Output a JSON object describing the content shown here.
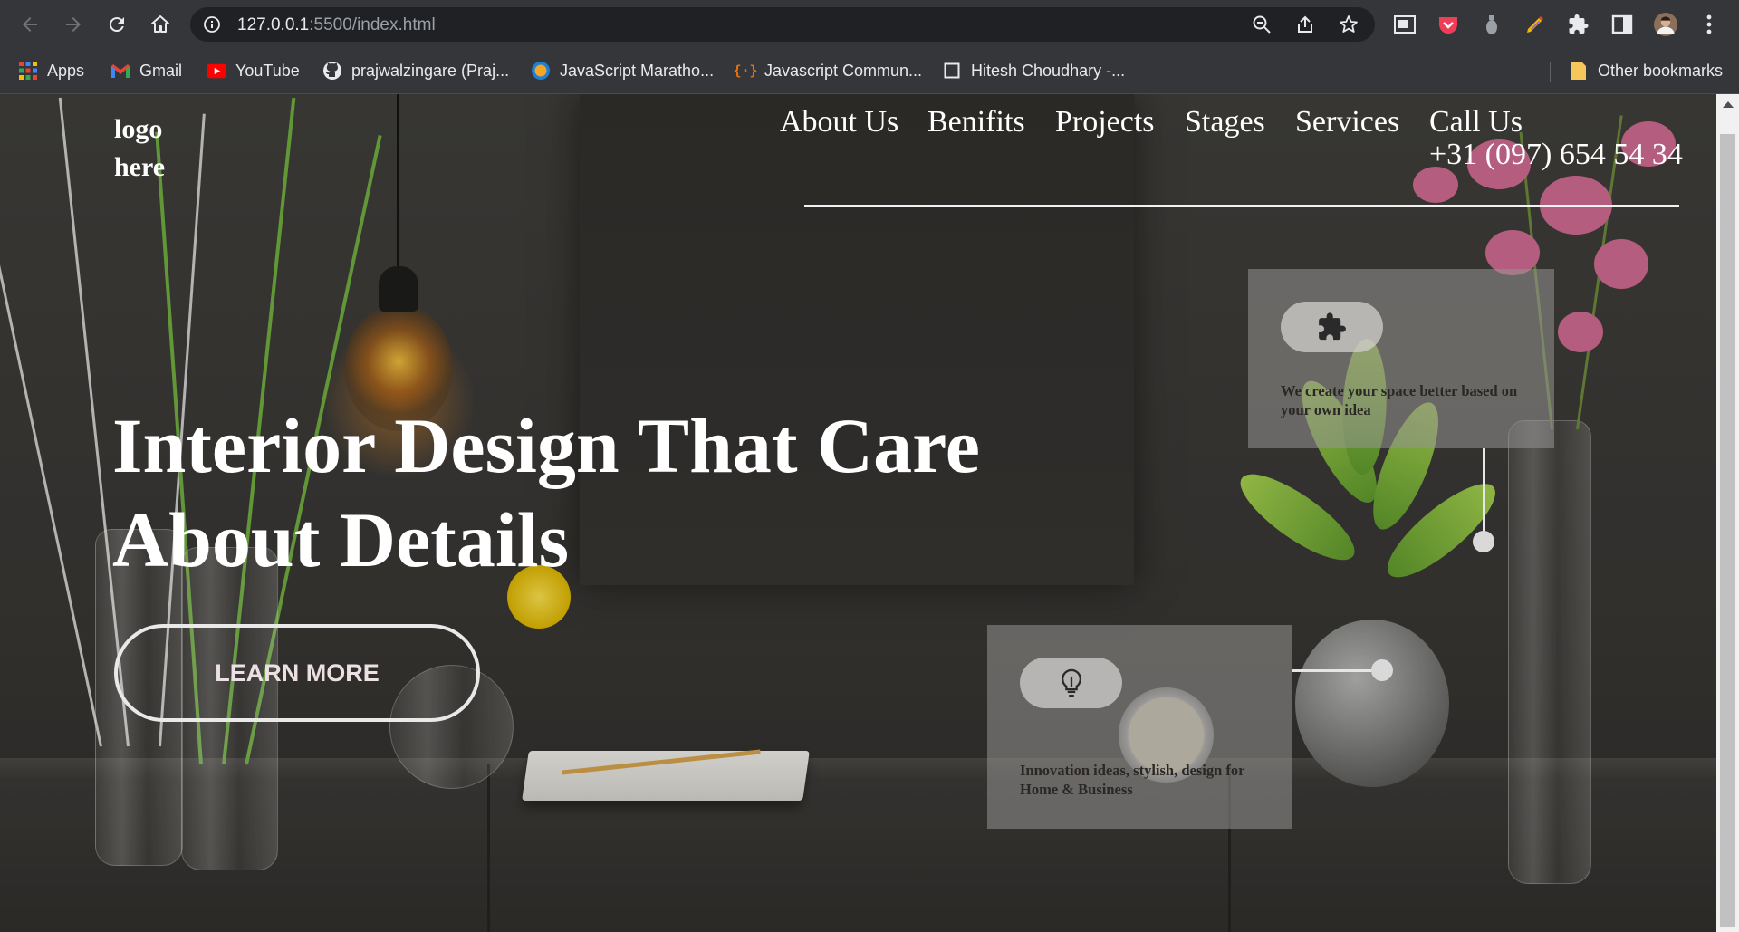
{
  "browser": {
    "url_host": "127.0.0.1",
    "url_path": ":5500/index.html",
    "bookmarks": [
      {
        "label": "Apps",
        "icon": "apps-grid-icon"
      },
      {
        "label": "Gmail",
        "icon": "gmail-icon"
      },
      {
        "label": "YouTube",
        "icon": "youtube-icon"
      },
      {
        "label": "prajwalzingare (Praj...",
        "icon": "github-icon"
      },
      {
        "label": "JavaScript Maratho...",
        "icon": "site-icon"
      },
      {
        "label": "Javascript Commun...",
        "icon": "code-icon"
      },
      {
        "label": "Hitesh Choudhary -...",
        "icon": "page-icon"
      }
    ],
    "other_bookmarks": "Other bookmarks"
  },
  "page": {
    "logo": "logo here",
    "nav": [
      "About Us",
      "Benifits",
      "Projects",
      "Stages",
      "Services",
      "Call Us"
    ],
    "phone": "+31 (097) 654 54 34",
    "hero_title": "Interior Design That Care About Details",
    "cta_label": "LEARN MORE",
    "card_top_text": "We create your space better based on your own idea",
    "card_bottom_text": "Innovation ideas, stylish, design for Home & Business"
  },
  "colors": {
    "browser_bar": "#35363a",
    "omnibox": "#202124",
    "page_text": "#ffffff",
    "card_bg": "#969492"
  }
}
